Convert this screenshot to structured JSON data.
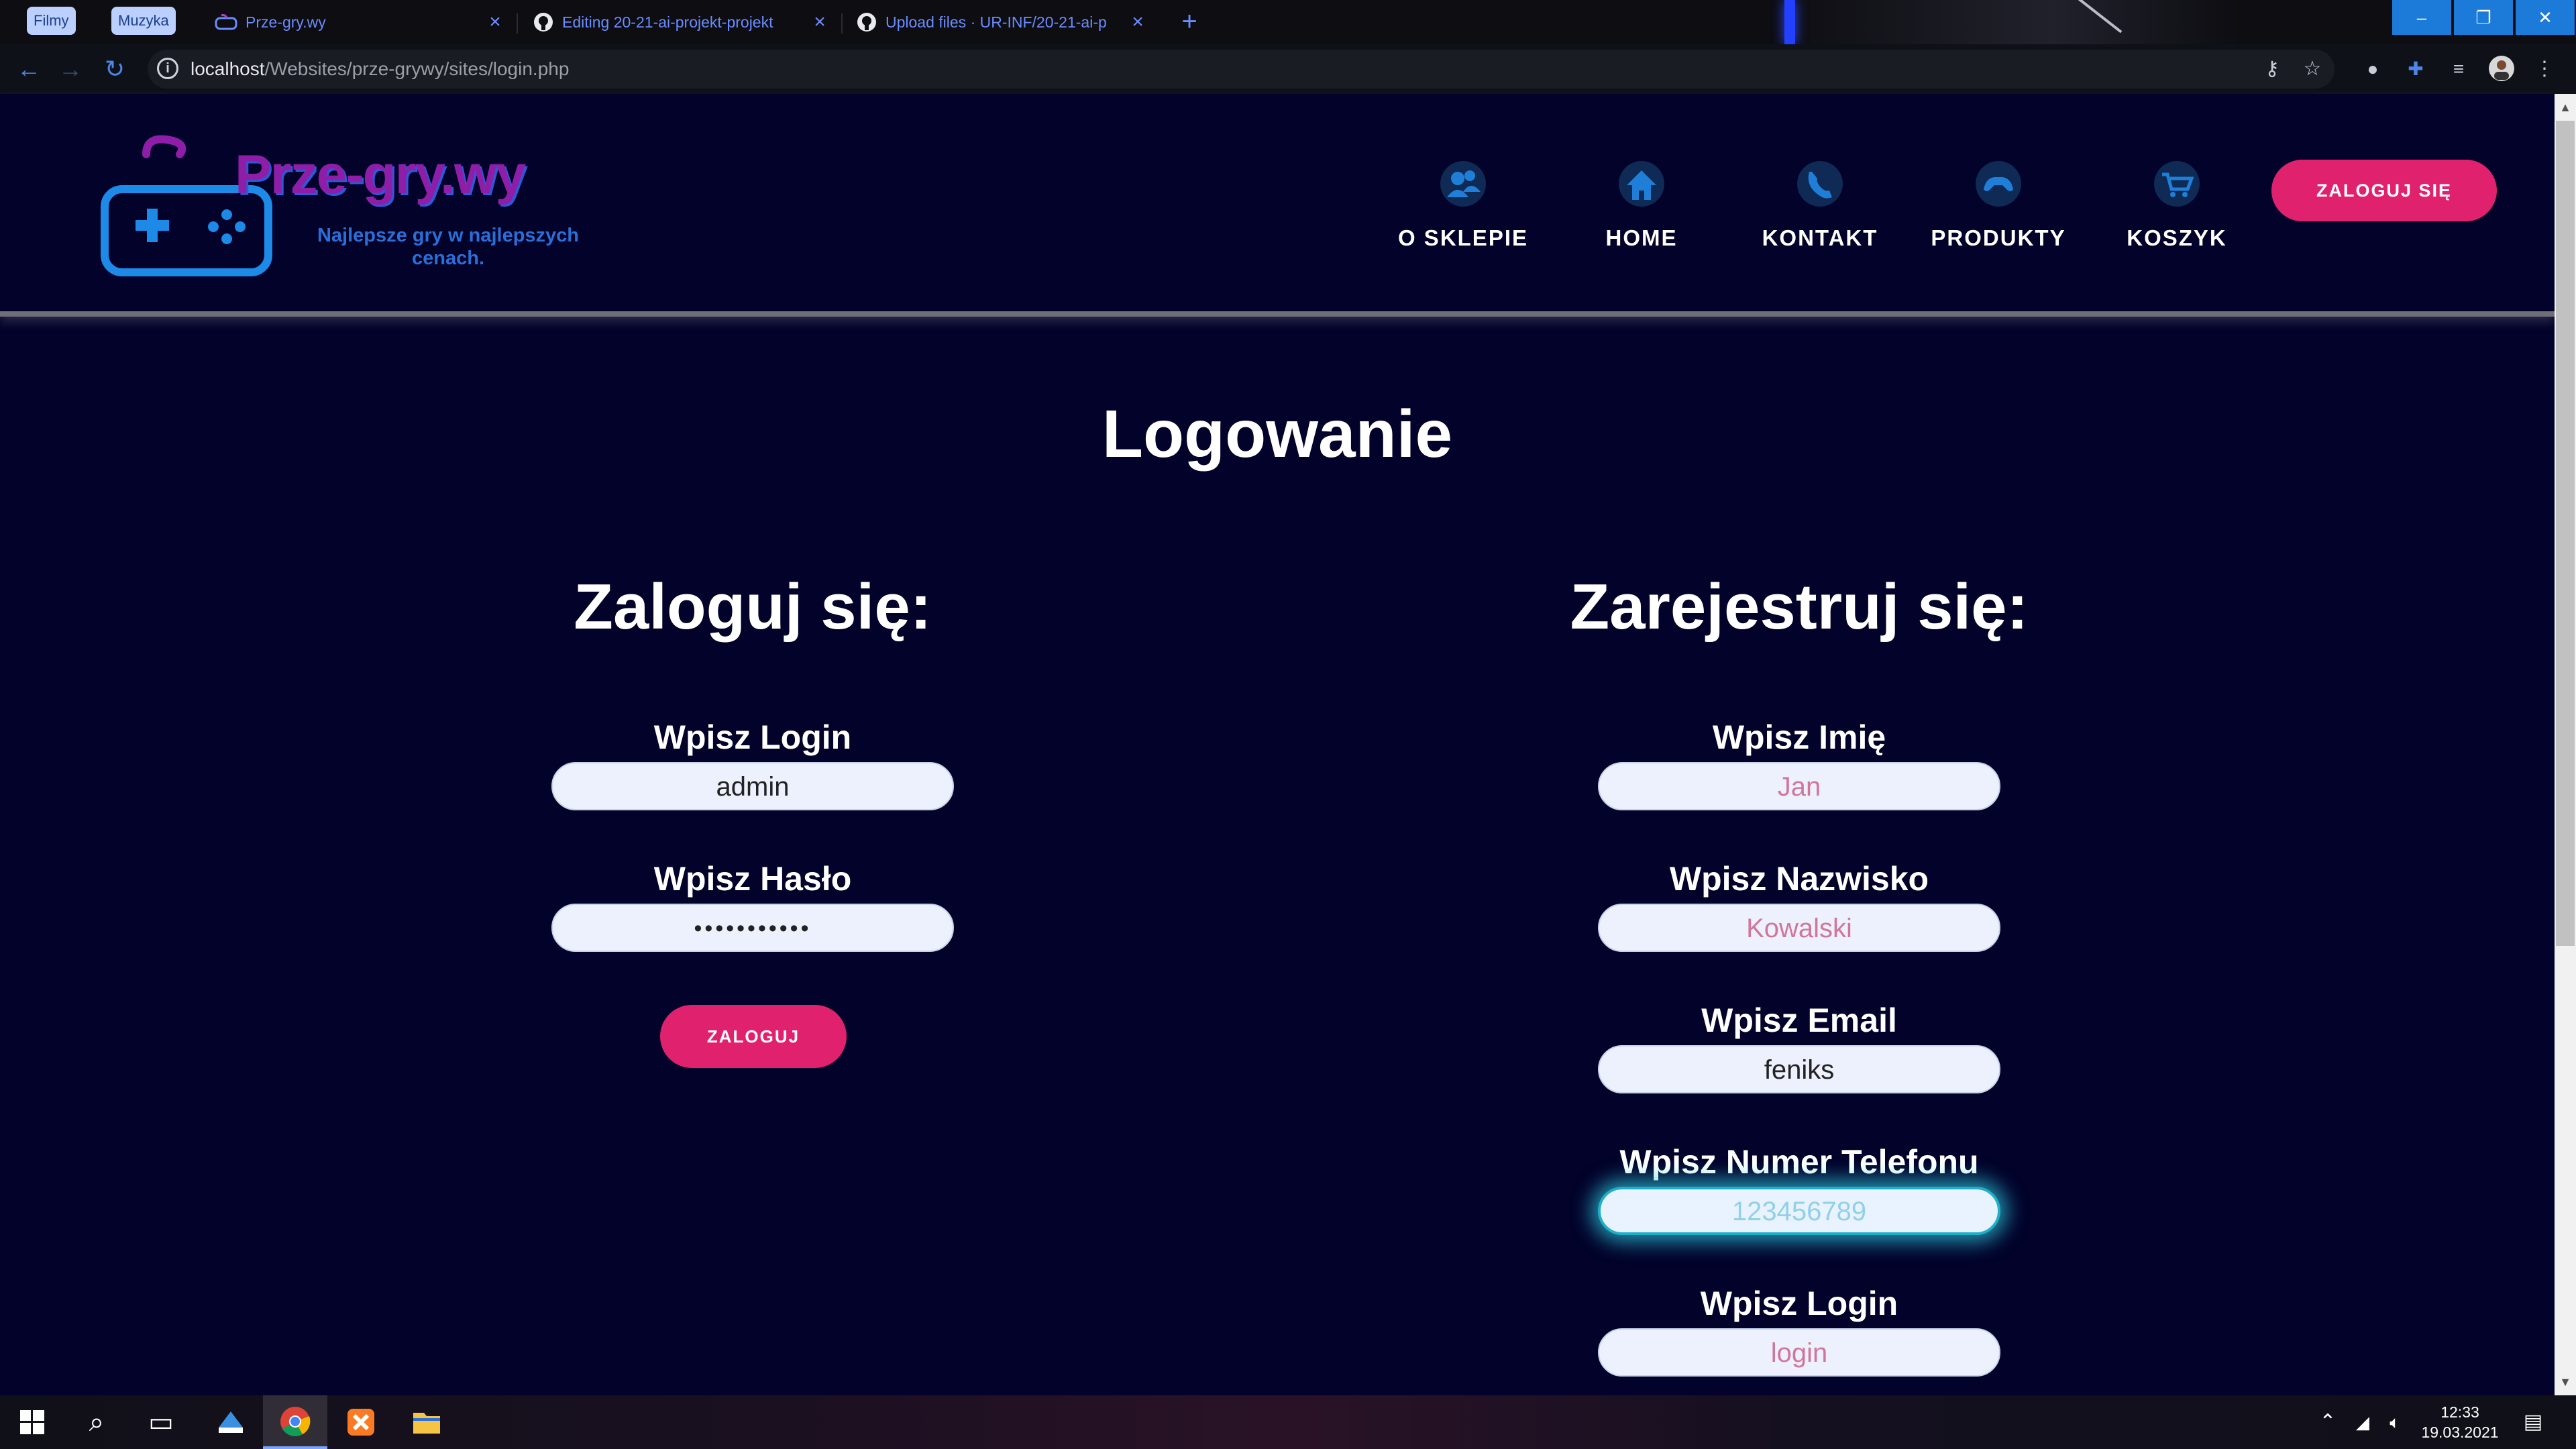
{
  "browser": {
    "bookmarks": [
      "Filmy",
      "Muzyka"
    ],
    "tabs": [
      {
        "title": "Prze-gry.wy"
      },
      {
        "title": "Editing 20-21-ai-projekt-projekt"
      },
      {
        "title": "Upload files · UR-INF/20-21-ai-p"
      }
    ],
    "new_tab": "+",
    "address": {
      "host": "localhost",
      "path": "/Websites/prze-grywy/sites/login.php"
    },
    "window_controls": {
      "minimize": "–",
      "restore": "❐",
      "close": "✕"
    }
  },
  "site": {
    "logo_title": "Prze-gry.wy",
    "tagline_1": "Najlepsze gry w najlepszych",
    "tagline_2": "cenach.",
    "nav": [
      {
        "label": "O SKLEPIE",
        "icon": "users-icon"
      },
      {
        "label": "HOME",
        "icon": "home-icon"
      },
      {
        "label": "KONTAKT",
        "icon": "phone-icon"
      },
      {
        "label": "PRODUKTY",
        "icon": "gamepad-icon"
      },
      {
        "label": "KOSZYK",
        "icon": "cart-icon"
      }
    ],
    "login_button": "ZALOGUJ SIĘ",
    "accent_color": "#e0226e",
    "bg_color": "#02022a"
  },
  "main": {
    "title": "Logowanie",
    "login": {
      "heading": "Zaloguj się:",
      "login_label": "Wpisz Login",
      "login_value": "admin",
      "password_label": "Wpisz Hasło",
      "password_value": "•••••••••••",
      "submit": "ZALOGUJ"
    },
    "register": {
      "heading": "Zarejestruj się:",
      "name_label": "Wpisz Imię",
      "name_placeholder": "Jan",
      "surname_label": "Wpisz Nazwisko",
      "surname_placeholder": "Kowalski",
      "email_label": "Wpisz Email",
      "email_value": "feniks",
      "phone_label": "Wpisz Numer Telefonu",
      "phone_placeholder": "123456789",
      "login_label": "Wpisz Login",
      "login_placeholder": "login"
    }
  },
  "taskbar": {
    "time": "12:33",
    "date": "19.03.2021"
  }
}
